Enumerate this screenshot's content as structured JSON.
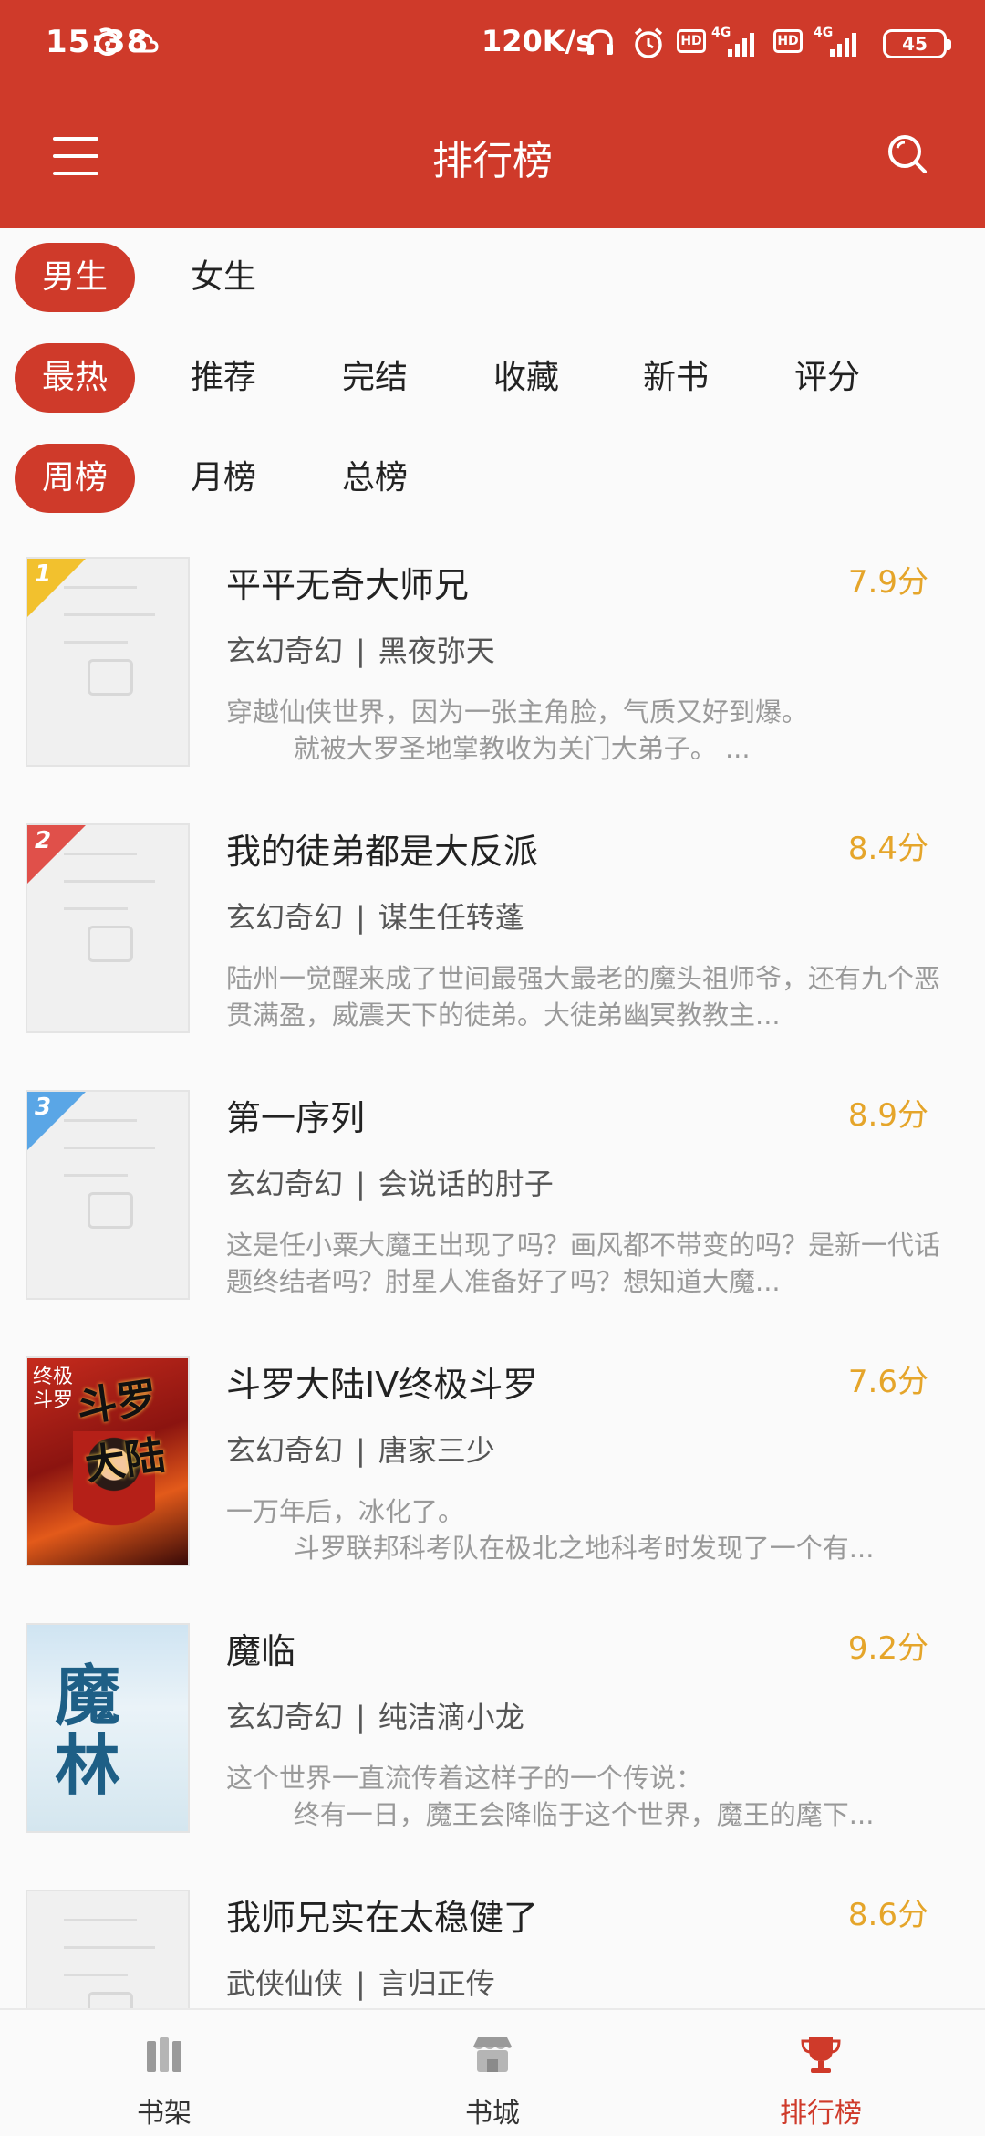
{
  "status_bar": {
    "time": "15:38",
    "speed": "120K/s",
    "hd1": "HD",
    "hd2": "HD",
    "net1": "4G",
    "net2": "4G",
    "battery": "45"
  },
  "header": {
    "title": "排行榜",
    "menu_icon": "menu-icon",
    "search_icon": "search-icon"
  },
  "colors": {
    "primary": "#cf3a2a",
    "score": "#e5a52a",
    "rank1": "#f2c12e",
    "rank2": "#e0504a",
    "rank3": "#5aa6e6"
  },
  "filters": {
    "gender": [
      {
        "label": "男生",
        "active": true
      },
      {
        "label": "女生",
        "active": false
      }
    ],
    "category": [
      {
        "label": "最热",
        "active": true
      },
      {
        "label": "推荐",
        "active": false
      },
      {
        "label": "完结",
        "active": false
      },
      {
        "label": "收藏",
        "active": false
      },
      {
        "label": "新书",
        "active": false
      },
      {
        "label": "评分",
        "active": false
      }
    ],
    "period": [
      {
        "label": "周榜",
        "active": true
      },
      {
        "label": "月榜",
        "active": false
      },
      {
        "label": "总榜",
        "active": false
      }
    ]
  },
  "books": [
    {
      "rank": "1",
      "title": "平平无奇大师兄",
      "score": "7.9分",
      "genre": "玄幻奇幻",
      "author": "黑夜弥天",
      "desc": "穿越仙侠世界，因为一张主角脸，气质又好到爆。\n        就被大罗圣地掌教收为关门大弟子。 ..."
    },
    {
      "rank": "2",
      "title": "我的徒弟都是大反派",
      "score": "8.4分",
      "genre": "玄幻奇幻",
      "author": "谋生任转蓬",
      "desc": "陆州一觉醒来成了世间最强大最老的魔头祖师爷，还有九个恶贯满盈，威震天下的徒弟。大徒弟幽冥教教主..."
    },
    {
      "rank": "3",
      "title": "第一序列",
      "score": "8.9分",
      "genre": "玄幻奇幻",
      "author": "会说话的肘子",
      "desc": "这是任小粟大魔王出现了吗？画风都不带变的吗？是新一代话题终结者吗？肘星人准备好了吗？想知道大魔..."
    },
    {
      "rank": "",
      "title": "斗罗大陆IV终极斗罗",
      "score": "7.6分",
      "genre": "玄幻奇幻",
      "author": "唐家三少",
      "desc": "一万年后，冰化了。\n        斗罗联邦科考队在极北之地科考时发现了一个有...",
      "cover_text": "斗罗大陆",
      "cover_side": "终极 斗罗"
    },
    {
      "rank": "",
      "title": "魔临",
      "score": "9.2分",
      "genre": "玄幻奇幻",
      "author": "纯洁滴小龙",
      "desc": "这个世界一直流传着这样子的一个传说：\n        终有一日，魔王会降临于这个世界，魔王的麾下...",
      "cover_text": "魔 林"
    },
    {
      "rank": "",
      "title": "我师兄实在太稳健了",
      "score": "8.6分",
      "genre": "武侠仙侠",
      "author": "言归正传",
      "desc": ""
    }
  ],
  "bottom_nav": [
    {
      "label": "书架",
      "icon": "bookshelf-icon",
      "active": false
    },
    {
      "label": "书城",
      "icon": "store-icon",
      "active": false
    },
    {
      "label": "排行榜",
      "icon": "trophy-icon",
      "active": true
    }
  ]
}
